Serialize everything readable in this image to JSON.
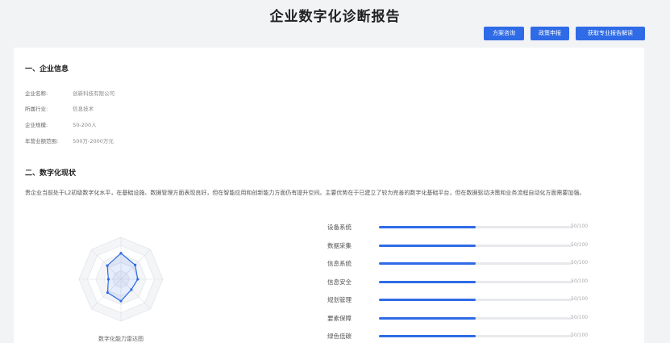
{
  "title": "企业数字化诊断报告",
  "actions": [
    "方案咨询",
    "政策申报",
    "获取专业报告解读"
  ],
  "section1": {
    "title": "一、企业信息",
    "fields": [
      {
        "label": "企业名称:",
        "value": "创新科技有限公司"
      },
      {
        "label": "所属行业:",
        "value": "信息技术"
      },
      {
        "label": "企业规模:",
        "value": "50-200人"
      },
      {
        "label": "年营业额范围:",
        "value": "500万-2000万元"
      }
    ]
  },
  "section2": {
    "title": "二、数字化现状",
    "summary": "贵企业当前处于L2初级数字化水平，在基础设施、数据管理方面表现良好，但在智能应用和创新能力方面仍有提升空间。主要优势在于已建立了较为完善的数字化基础平台，但在数据驱动决策和业务流程自动化方面需要加强。"
  },
  "radar": {
    "caption": "数字化能力雷达图",
    "levels": [
      0.62,
      0.48,
      0.4,
      0.35,
      0.52,
      0.45,
      0.3,
      0.46
    ]
  },
  "bars": [
    {
      "label": "设备系统",
      "score_text": "50/100",
      "value": 0.5
    },
    {
      "label": "数据采集",
      "score_text": "50/100",
      "value": 0.5
    },
    {
      "label": "信息系统",
      "score_text": "50/100",
      "value": 0.5
    },
    {
      "label": "信息安全",
      "score_text": "50/100",
      "value": 0.5
    },
    {
      "label": "规划管理",
      "score_text": "50/100",
      "value": 0.5
    },
    {
      "label": "要素保障",
      "score_text": "50/100",
      "value": 0.5
    },
    {
      "label": "绿色低碳",
      "score_text": "50/100",
      "value": 0.5
    }
  ],
  "colors": {
    "accent": "#2f6be6"
  }
}
